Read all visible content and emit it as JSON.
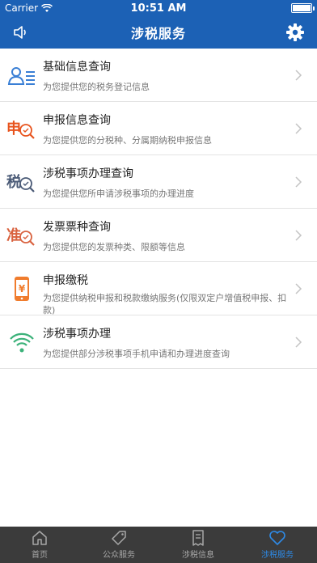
{
  "status_bar": {
    "carrier": "Carrier",
    "time": "10:51 AM"
  },
  "nav": {
    "title": "涉税服务"
  },
  "items": [
    {
      "title": "基础信息查询",
      "subtitle": "为您提供您的税务登记信息"
    },
    {
      "title": "申报信息查询",
      "subtitle": "为您提供您的分税种、分属期纳税申报信息"
    },
    {
      "title": "涉税事项办理查询",
      "subtitle": "为您提供您所申请涉税事项的办理进度"
    },
    {
      "title": "发票票种查询",
      "subtitle": "为您提供您的发票种类、限额等信息"
    },
    {
      "title": "申报缴税",
      "subtitle": "为您提供纳税申报和税款缴纳服务(仅限双定户增值税申报、扣款)"
    },
    {
      "title": "涉税事项办理",
      "subtitle": "为您提供部分涉税事项手机申请和办理进度查询"
    }
  ],
  "icon_glyphs": {
    "shen": "申",
    "shui": "税",
    "zhun": "准"
  },
  "tabs": [
    {
      "label": "首页"
    },
    {
      "label": "公众服务"
    },
    {
      "label": "涉税信息"
    },
    {
      "label": "涉税服务"
    }
  ],
  "colors": {
    "brand": "#1c61b5",
    "tab_active": "#2e8ae6",
    "tab_bar": "#3b3b3b"
  }
}
